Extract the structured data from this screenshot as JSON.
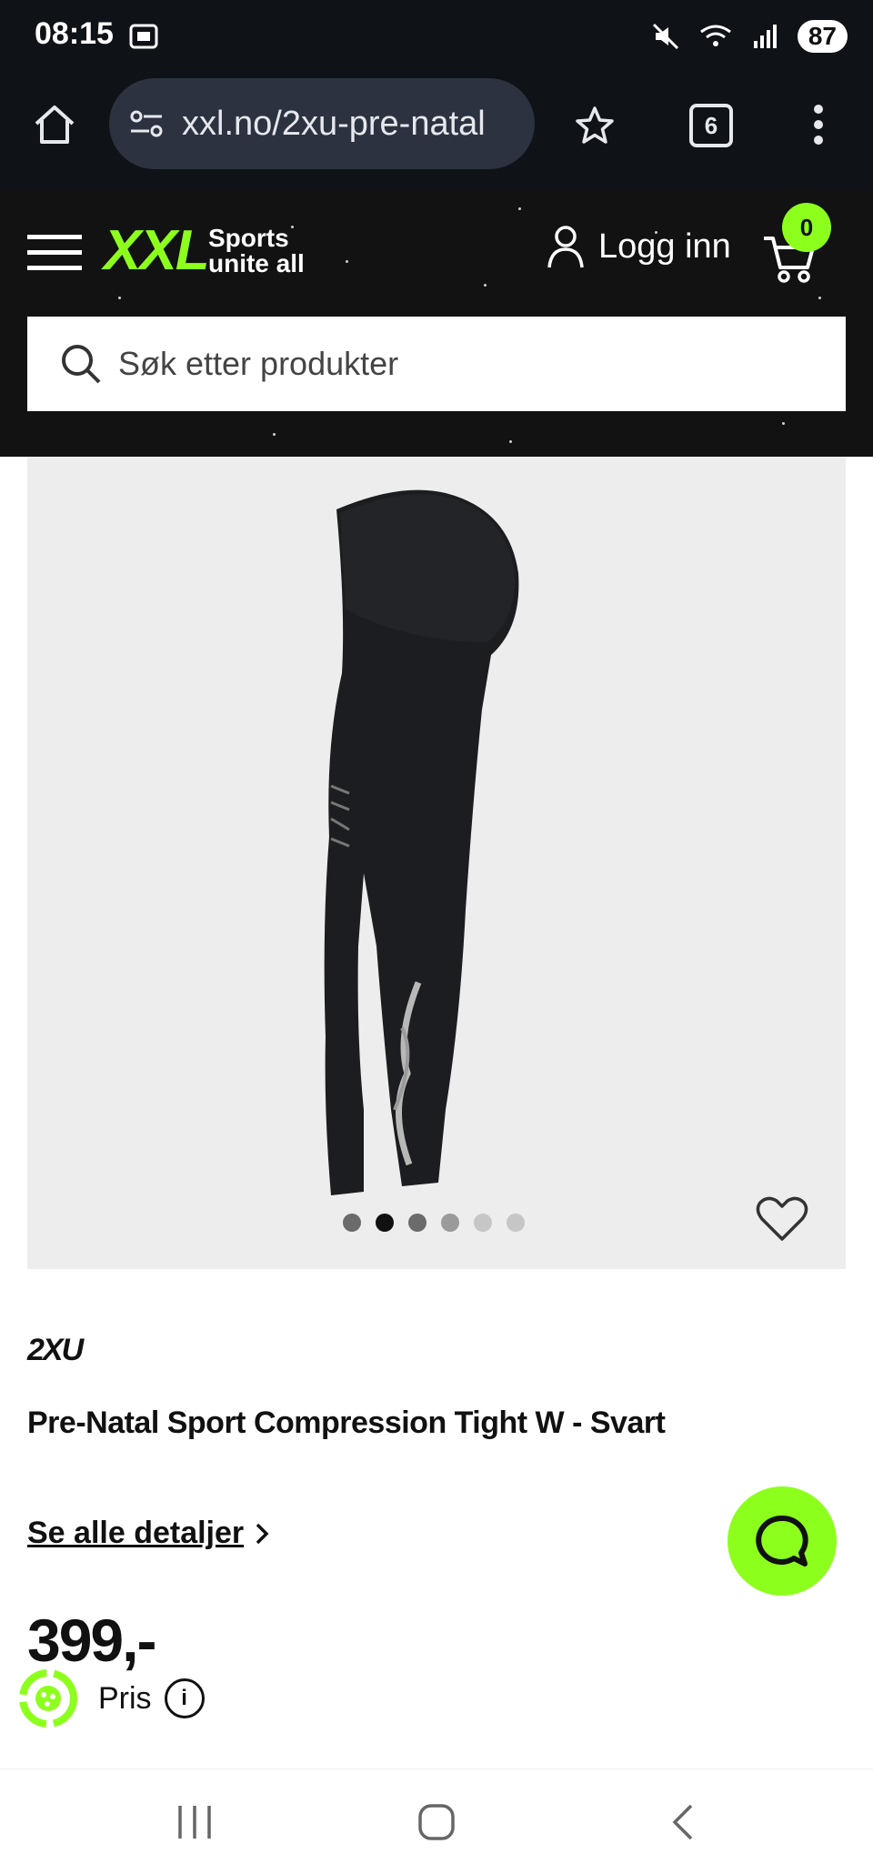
{
  "status_bar": {
    "time": "08:15",
    "battery": "87"
  },
  "browser": {
    "url": "xxl.no/2xu-pre-natal",
    "tab_count": "6"
  },
  "header": {
    "logo_text": "XXL",
    "tagline_line1": "Sports",
    "tagline_line2": "unite all",
    "login_label": "Logg inn",
    "cart_count": "0",
    "search_placeholder": "Søk etter produkter"
  },
  "gallery": {
    "image_count": 6,
    "active_index": 1
  },
  "product": {
    "brand": "2XU",
    "title": "Pre-Natal Sport Compression Tight W - Svart",
    "details_link": "Se alle detaljer",
    "price": "399,-",
    "price_label": "Pris"
  },
  "colors": {
    "accent": "#8dff1c",
    "header_bg": "#121212",
    "browser_bg": "#0f1217"
  }
}
